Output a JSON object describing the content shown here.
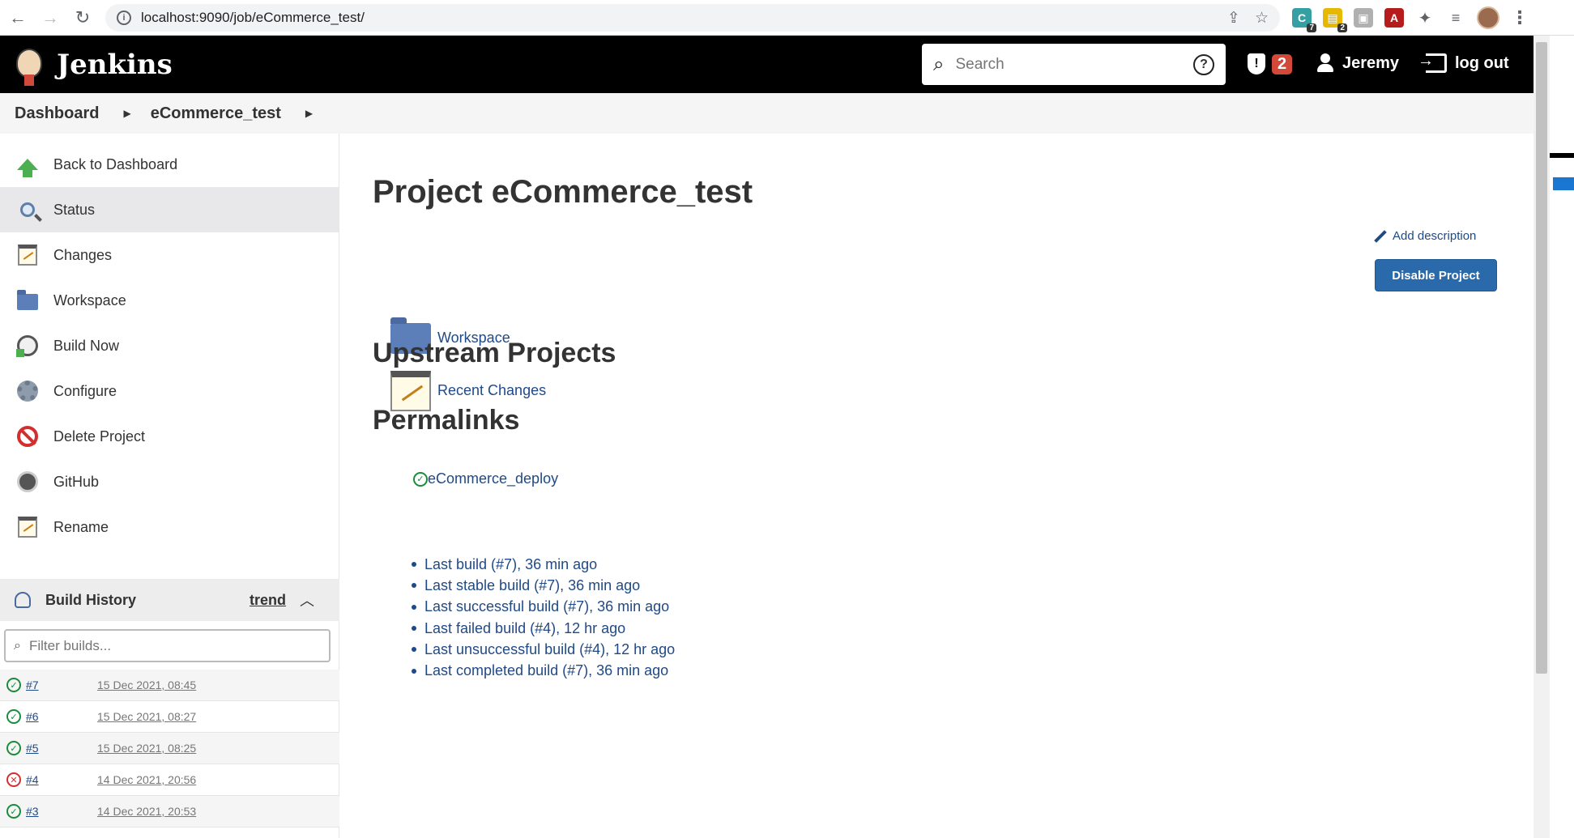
{
  "browser": {
    "url": "localhost:9090/job/eCommerce_test/",
    "extensions": [
      {
        "name": "ext-c-icon",
        "badge": "7",
        "color": "#34a0a4"
      },
      {
        "name": "ext-notes-icon",
        "badge": "2",
        "color": "#e6b800"
      },
      {
        "name": "ext-gray-icon",
        "badge": "",
        "color": "#b0b0b0"
      },
      {
        "name": "ext-pdf-icon",
        "badge": "",
        "color": "#b71c1c"
      }
    ]
  },
  "header": {
    "app_title": "Jenkins",
    "search_placeholder": "Search",
    "alert_count": "2",
    "user_name": "Jeremy",
    "logout_label": "log out"
  },
  "breadcrumb": [
    "Dashboard",
    "eCommerce_test"
  ],
  "sidebar": {
    "items": [
      {
        "label": "Back to Dashboard",
        "icon": "arrow-up-icon"
      },
      {
        "label": "Status",
        "icon": "magnifier-icon"
      },
      {
        "label": "Changes",
        "icon": "notepad-icon"
      },
      {
        "label": "Workspace",
        "icon": "folder-icon"
      },
      {
        "label": "Build Now",
        "icon": "clock-icon"
      },
      {
        "label": "Configure",
        "icon": "gear-icon"
      },
      {
        "label": "Delete Project",
        "icon": "no-entry-icon"
      },
      {
        "label": "GitHub",
        "icon": "github-icon"
      },
      {
        "label": "Rename",
        "icon": "notepad-icon"
      }
    ]
  },
  "build_history": {
    "title": "Build History",
    "trend_label": "trend",
    "filter_placeholder": "Filter builds...",
    "builds": [
      {
        "number": "#7",
        "date": "15 Dec 2021, 08:45",
        "status": "success"
      },
      {
        "number": "#6",
        "date": "15 Dec 2021, 08:27",
        "status": "success"
      },
      {
        "number": "#5",
        "date": "15 Dec 2021, 08:25",
        "status": "success"
      },
      {
        "number": "#4",
        "date": "14 Dec 2021, 20:56",
        "status": "failed"
      },
      {
        "number": "#3",
        "date": "14 Dec 2021, 20:53",
        "status": "success"
      }
    ]
  },
  "main": {
    "title": "Project eCommerce_test",
    "add_description": "Add description",
    "disable_button": "Disable Project",
    "links": {
      "workspace": "Workspace",
      "recent_changes": "Recent Changes"
    },
    "upstream_heading": "Upstream Projects",
    "upstream_project": "eCommerce_deploy",
    "permalinks_heading": "Permalinks",
    "permalinks": [
      "Last build (#7), 36 min ago",
      "Last stable build (#7), 36 min ago",
      "Last successful build (#7), 36 min ago",
      "Last failed build (#4), 12 hr ago",
      "Last unsuccessful build (#4), 12 hr ago",
      "Last completed build (#7), 36 min ago"
    ]
  }
}
